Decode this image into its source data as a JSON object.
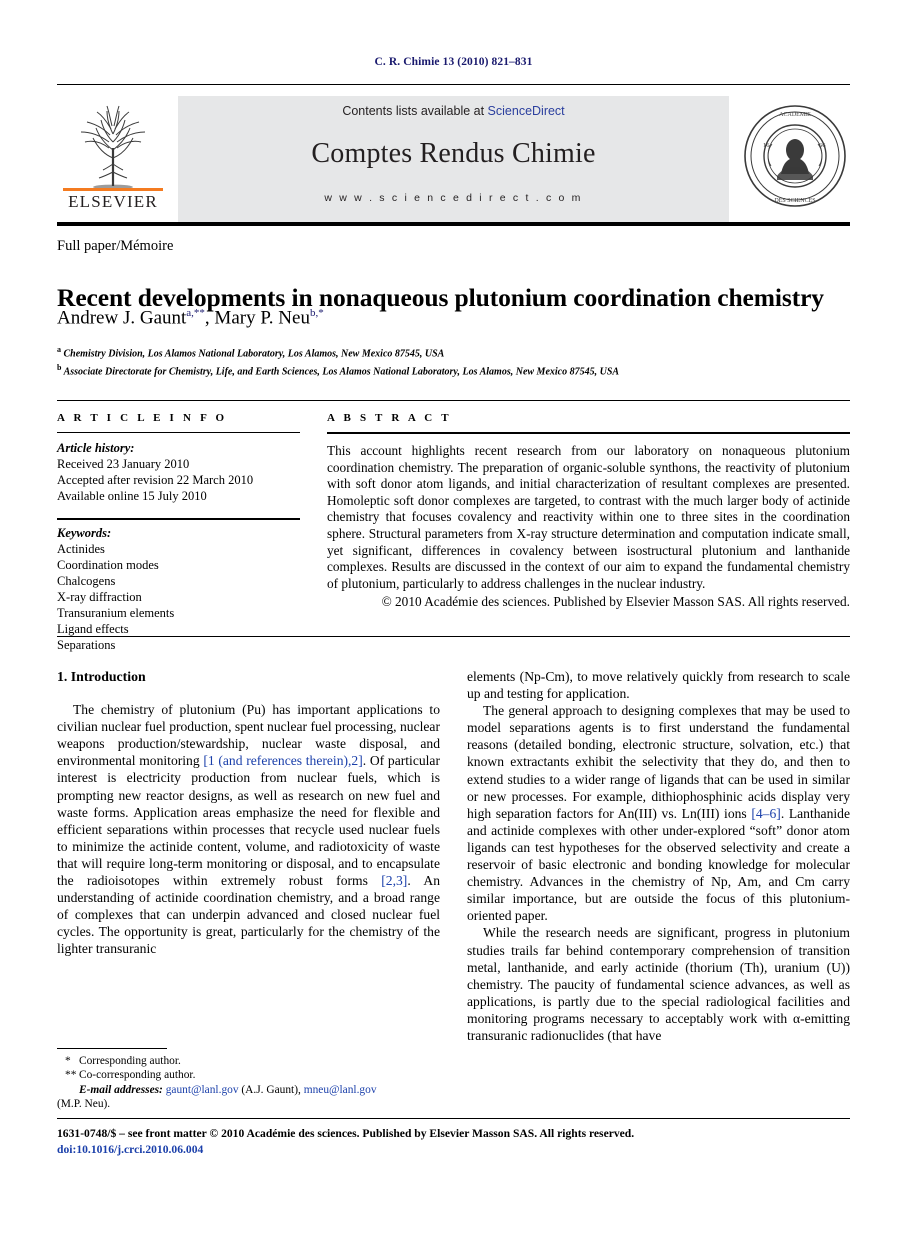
{
  "running_head": "C. R. Chimie 13 (2010) 821–831",
  "masthead": {
    "contents_prefix": "Contents lists available at ",
    "sciencedirect": "ScienceDirect",
    "journal_title": "Comptes Rendus Chimie",
    "url": "w w w . s c i e n c e d i r e c t . c o m",
    "publisher_word": "ELSEVIER",
    "accent_orange": "#f47b20",
    "link_blue": "#2b3f9e",
    "band_gray": "#e6e7e8"
  },
  "article": {
    "type": "Full paper/Mémoire",
    "title": "Recent developments in nonaqueous plutonium coordination chemistry",
    "authors_part1": "Andrew J. Gaunt",
    "authors_mark1": "a,**",
    "authors_sep": ", ",
    "authors_part2": "Mary P. Neu",
    "authors_mark2": "b,*",
    "affiliation_a_mark": "a",
    "affiliation_a": " Chemistry Division, Los Alamos National Laboratory, Los Alamos, New Mexico 87545, USA",
    "affiliation_b_mark": "b",
    "affiliation_b": " Associate Directorate for Chemistry, Life, and Earth Sciences, Los Alamos National Laboratory, Los Alamos, New Mexico 87545, USA"
  },
  "info": {
    "heading": "A R T I C L E   I N F O",
    "history_label": "Article history:",
    "history": [
      "Received 23 January 2010",
      "Accepted after revision 22 March 2010",
      "Available online 15 July 2010"
    ],
    "keywords_label": "Keywords:",
    "keywords": [
      "Actinides",
      "Coordination modes",
      "Chalcogens",
      "X-ray diffraction",
      "Transuranium elements",
      "Ligand effects",
      "Separations"
    ]
  },
  "abstract": {
    "heading": "A B S T R A C T",
    "text": "This account highlights recent research from our laboratory on nonaqueous plutonium coordination chemistry. The preparation of organic-soluble synthons, the reactivity of plutonium with soft donor atom ligands, and initial characterization of resultant complexes are presented. Homoleptic soft donor complexes are targeted, to contrast with the much larger body of actinide chemistry that focuses covalency and reactivity within one to three sites in the coordination sphere. Structural parameters from X-ray structure determination and computation indicate small, yet significant, differences in covalency between isostructural plutonium and lanthanide complexes. Results are discussed in the context of our aim to expand the fundamental chemistry of plutonium, particularly to address challenges in the nuclear industry.",
    "copyright": "© 2010 Académie des sciences. Published by Elsevier Masson SAS. All rights reserved."
  },
  "body": {
    "section_number_title": "1.  Introduction",
    "left": {
      "para1_a": "The chemistry of plutonium (Pu) has important applications to civilian nuclear fuel production, spent nuclear fuel processing, nuclear weapons production/stewardship, nuclear waste disposal, and environmental monitoring ",
      "para1_cite1": "[1 (and references therein),2]",
      "para1_b": ". Of particular interest is electricity production from nuclear fuels, which is prompting new reactor designs, as well as research on new fuel and waste forms. Application areas emphasize the need for flexible and efficient separations within processes that recycle used nuclear fuels to minimize the actinide content, volume, and radiotoxicity of waste that will require long-term monitoring or disposal, and to encapsulate the radioisotopes within extremely robust forms ",
      "para1_cite2": "[2,3]",
      "para1_c": ". An understanding of actinide coordination chemistry, and a broad range of complexes that can underpin advanced and closed nuclear fuel cycles. The opportunity is great, particularly for the chemistry of the lighter transuranic"
    },
    "right": {
      "para1": "elements (Np-Cm), to move relatively quickly from research to scale up and testing for application.",
      "para2_a": "The general approach to designing complexes that may be used to model separations agents is to first understand the fundamental reasons (detailed bonding, electronic structure, solvation, etc.) that known extractants exhibit the selectivity that they do, and then to extend studies to a wider range of ligands that can be used in similar or new processes. For example, dithiophosphinic acids display very high separation factors for An(III) vs. Ln(III) ions ",
      "para2_cite": "[4–6]",
      "para2_b": ". Lanthanide and actinide complexes with other under-explored “soft” donor atom ligands can test hypotheses for the observed selectivity and create a reservoir of basic electronic and bonding knowledge for molecular chemistry. Advances in the chemistry of Np, Am, and Cm carry similar importance, but are outside the focus of this plutonium-oriented paper.",
      "para3": "While the research needs are significant, progress in plutonium studies trails far behind contemporary comprehension of transition metal, lanthanide, and early actinide (thorium (Th), uranium (U)) chemistry. The paucity of fundamental science advances, as well as applications, is partly due to the special radiological facilities and monitoring programs necessary to acceptably work with α-emitting transuranic radionuclides (that have"
    }
  },
  "footnotes": {
    "mark1": "*",
    "note1": "Corresponding author.",
    "mark2": "**",
    "note2": "Co-corresponding author.",
    "email_label": "E-mail addresses:",
    "email1": "gaunt@lanl.gov",
    "email1_who": " (A.J. Gaunt), ",
    "email2": "mneu@lanl.gov",
    "email2_who": "(M.P. Neu)."
  },
  "footer": {
    "issn_line": "1631-0748/$ – see front matter © 2010 Académie des sciences. Published by Elsevier Masson SAS. All rights reserved.",
    "doi": "doi:10.1016/j.crci.2010.06.004"
  }
}
